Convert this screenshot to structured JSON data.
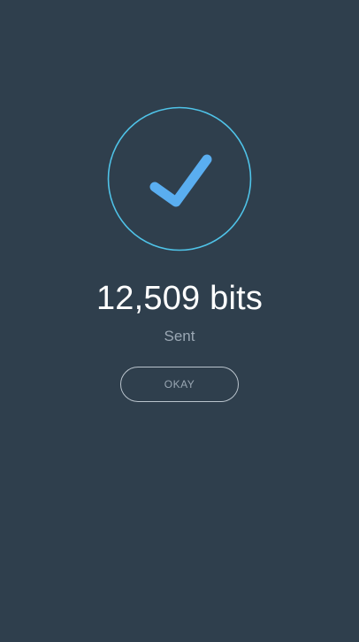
{
  "confirmation": {
    "amount_text": "12,509 bits",
    "status_text": "Sent",
    "okay_label": "OKAY",
    "icon": "checkmark-circle-icon"
  },
  "colors": {
    "background": "#2f3f4d",
    "ring": "#4fc3e8",
    "checkmark": "#5aaef0",
    "amount_text": "#ffffff",
    "secondary_text": "#9aa7b3",
    "button_border": "#b9c3cc"
  }
}
